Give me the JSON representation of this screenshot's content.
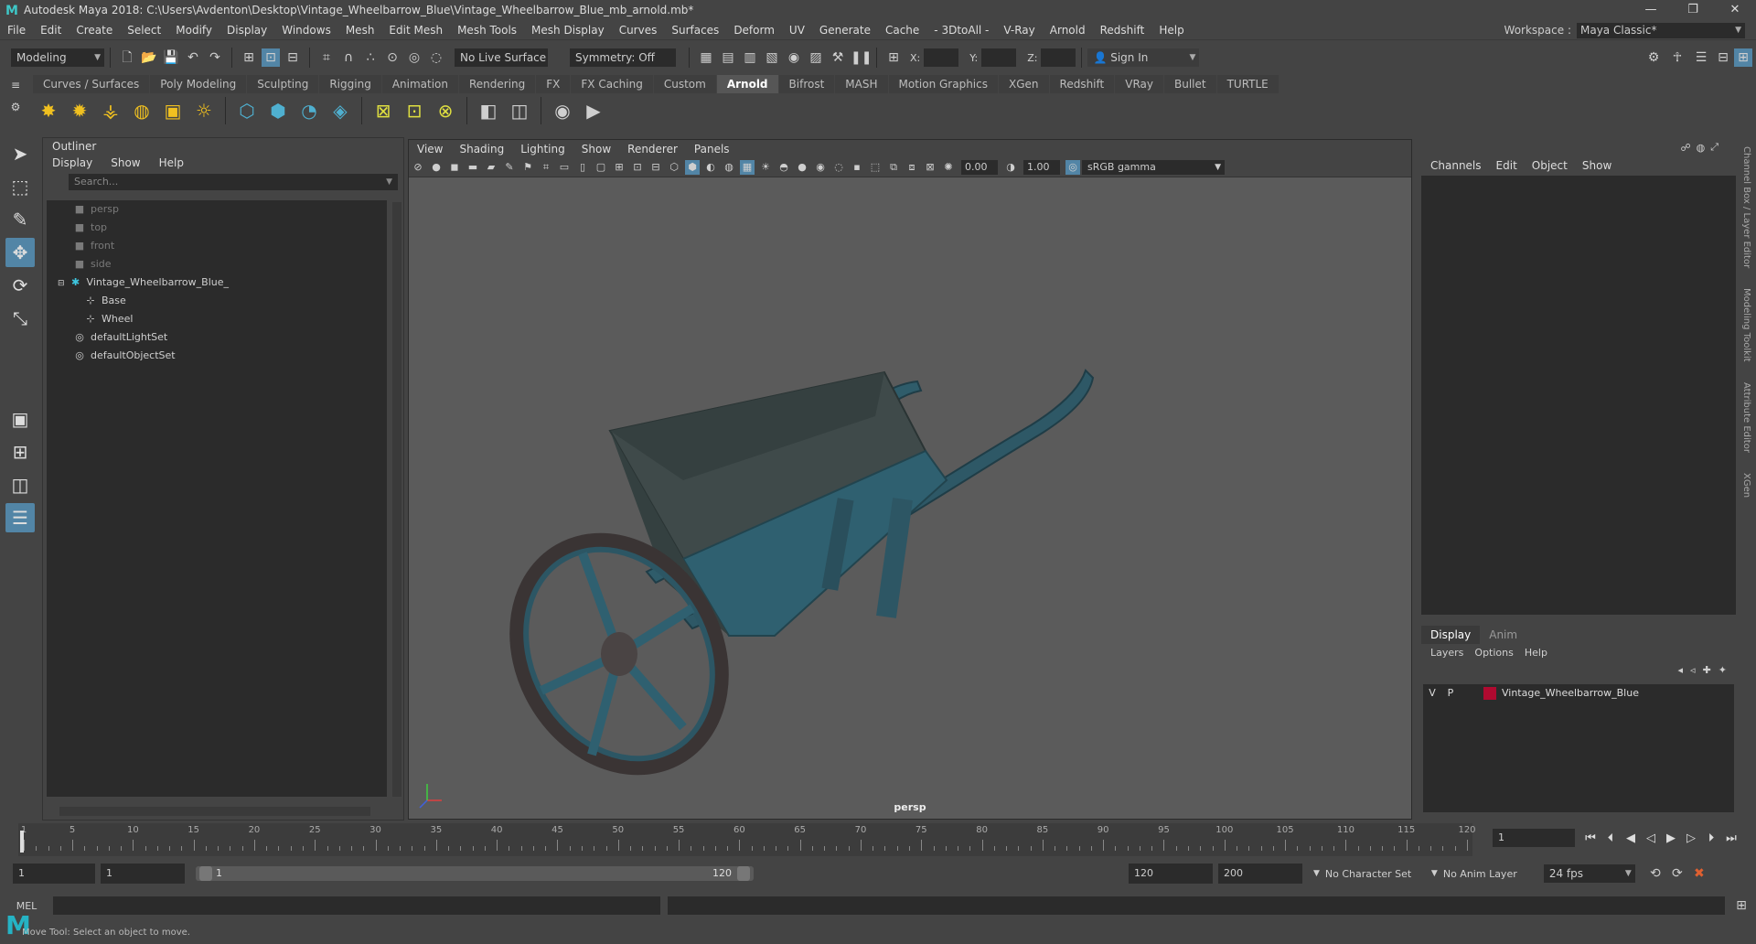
{
  "window": {
    "title": "Autodesk Maya 2018: C:\\Users\\Avdenton\\Desktop\\Vintage_Wheelbarrow_Blue\\Vintage_Wheelbarrow_Blue_mb_arnold.mb*",
    "logo": "M",
    "controls": [
      "—",
      "❐",
      "✕"
    ]
  },
  "menubar": {
    "items": [
      "File",
      "Edit",
      "Create",
      "Select",
      "Modify",
      "Display",
      "Windows",
      "Mesh",
      "Edit Mesh",
      "Mesh Tools",
      "Mesh Display",
      "Curves",
      "Surfaces",
      "Deform",
      "UV",
      "Generate",
      "Cache",
      "- 3DtoAll -",
      "V-Ray",
      "Arnold",
      "Redshift",
      "Help"
    ],
    "workspace_label": "Workspace :",
    "workspace_value": "Maya Classic*"
  },
  "statusline": {
    "mode": "Modeling",
    "live_surface": "No Live Surface",
    "symmetry": "Symmetry: Off",
    "x_label": "X:",
    "y_label": "Y:",
    "z_label": "Z:",
    "sign_in": "Sign In"
  },
  "shelf": {
    "tabs": [
      "Curves / Surfaces",
      "Poly Modeling",
      "Sculpting",
      "Rigging",
      "Animation",
      "Rendering",
      "FX",
      "FX Caching",
      "Custom",
      "Arnold",
      "Bifrost",
      "MASH",
      "Motion Graphics",
      "XGen",
      "Redshift",
      "VRay",
      "Bullet",
      "TURTLE"
    ],
    "active_tab": "Arnold"
  },
  "outliner": {
    "title": "Outliner",
    "menu": [
      "Display",
      "Show",
      "Help"
    ],
    "search_placeholder": "Search...",
    "items": [
      {
        "label": "persp",
        "icon": "camera-icon",
        "dim": true,
        "indent": 0
      },
      {
        "label": "top",
        "icon": "camera-icon",
        "dim": true,
        "indent": 0
      },
      {
        "label": "front",
        "icon": "camera-icon",
        "dim": true,
        "indent": 0
      },
      {
        "label": "side",
        "icon": "camera-icon",
        "dim": true,
        "indent": 0
      },
      {
        "label": "Vintage_Wheelbarrow_Blue_",
        "icon": "group-icon",
        "dim": false,
        "indent": 0
      },
      {
        "label": "Base",
        "icon": "mesh-icon",
        "dim": false,
        "indent": 1
      },
      {
        "label": "Wheel",
        "icon": "mesh-icon",
        "dim": false,
        "indent": 1
      },
      {
        "label": "defaultLightSet",
        "icon": "set-icon",
        "dim": false,
        "indent": 0
      },
      {
        "label": "defaultObjectSet",
        "icon": "set-icon",
        "dim": false,
        "indent": 0
      }
    ]
  },
  "viewport": {
    "menu": [
      "View",
      "Shading",
      "Lighting",
      "Show",
      "Renderer",
      "Panels"
    ],
    "exposure": "0.00",
    "gamma_value": "1.00",
    "color_space": "sRGB gamma",
    "camera": "persp"
  },
  "channelbox": {
    "menu": [
      "Channels",
      "Edit",
      "Object",
      "Show"
    ],
    "side_tabs": [
      "Channel Box / Layer Editor",
      "Modeling Toolkit",
      "Attribute Editor",
      "XGen"
    ]
  },
  "layer_editor": {
    "tabs": [
      "Display",
      "Anim"
    ],
    "active_tab": "Display",
    "menu": [
      "Layers",
      "Options",
      "Help"
    ],
    "layer": {
      "v": "V",
      "p": "P",
      "name": "Vintage_Wheelbarrow_Blue",
      "color": "#b00a30"
    }
  },
  "timeslider": {
    "ticks": [
      "1",
      "5",
      "10",
      "15",
      "20",
      "25",
      "30",
      "35",
      "40",
      "45",
      "50",
      "55",
      "60",
      "65",
      "70",
      "75",
      "80",
      "85",
      "90",
      "95",
      "100",
      "105",
      "110",
      "115",
      "120"
    ],
    "current_frame": "1"
  },
  "range": {
    "start": "1",
    "anim_start": "1",
    "slider_start": "1",
    "slider_end": "120",
    "end": "120",
    "anim_end": "200",
    "character_set": "No Character Set",
    "anim_layer": "No Anim Layer",
    "fps": "24 fps"
  },
  "cmdline": {
    "label": "MEL"
  },
  "helpline": {
    "text": "Move Tool: Select an object to move."
  },
  "colors": {
    "accent": "#5285a6",
    "maya_teal": "#25b3c4",
    "background": "#444444",
    "field": "#2b2b2b",
    "viewport": "#5b5b5b"
  }
}
